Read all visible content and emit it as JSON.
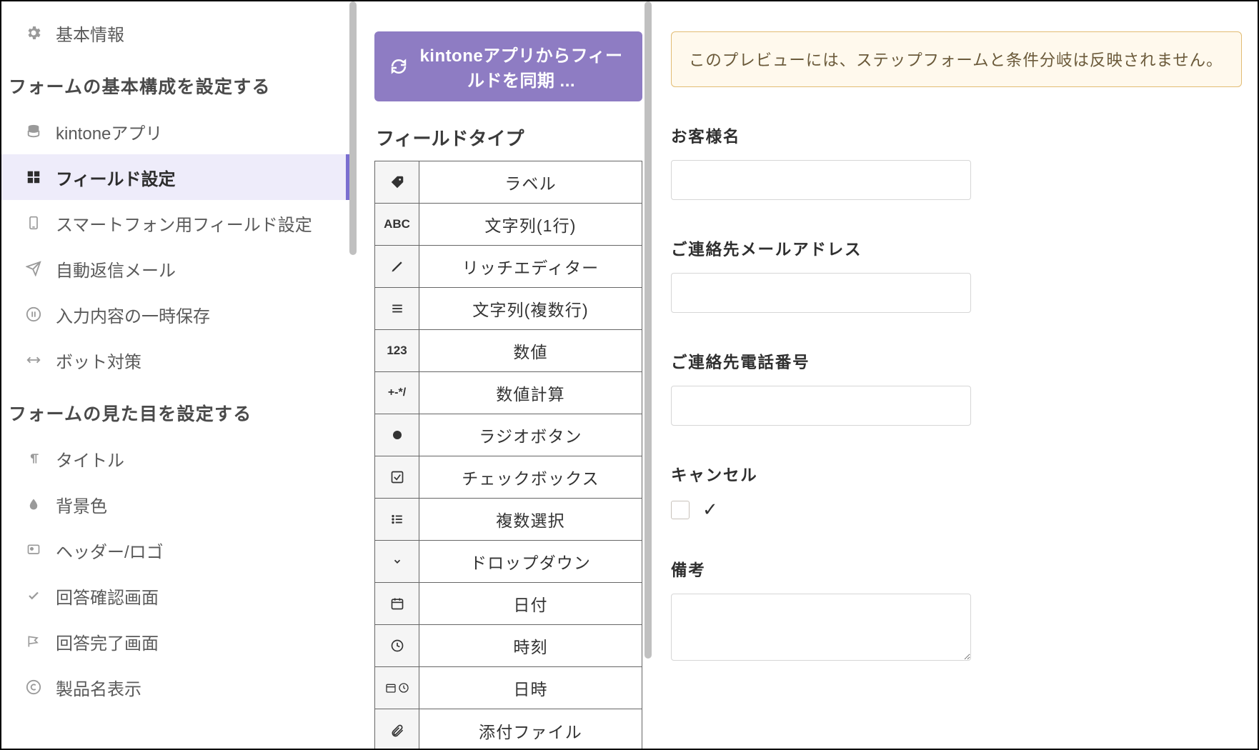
{
  "sidebar": {
    "basic": "基本情報",
    "section1": "フォームの基本構成を設定する",
    "items1": [
      {
        "label": "kintoneアプリ"
      },
      {
        "label": "フィールド設定"
      },
      {
        "label": "スマートフォン用フィールド設定"
      },
      {
        "label": "自動返信メール"
      },
      {
        "label": "入力内容の一時保存"
      },
      {
        "label": "ボット対策"
      }
    ],
    "section2": "フォームの見た目を設定する",
    "items2": [
      {
        "label": "タイトル"
      },
      {
        "label": "背景色"
      },
      {
        "label": "ヘッダー/ロゴ"
      },
      {
        "label": "回答確認画面"
      },
      {
        "label": "回答完了画面"
      },
      {
        "label": "製品名表示"
      }
    ]
  },
  "sync_button": "kintoneアプリからフィールドを同期 ...",
  "mid_heading": "フィールドタイプ",
  "fieldtypes": [
    {
      "icon": "tag",
      "label": "ラベル"
    },
    {
      "icon": "ABC",
      "label": "文字列(1行)"
    },
    {
      "icon": "pencil",
      "label": "リッチエディター"
    },
    {
      "icon": "bars",
      "label": "文字列(複数行)"
    },
    {
      "icon": "123",
      "label": "数値"
    },
    {
      "icon": "+-*/",
      "label": "数値計算"
    },
    {
      "icon": "dot",
      "label": "ラジオボタン"
    },
    {
      "icon": "cbox",
      "label": "チェックボックス"
    },
    {
      "icon": "list",
      "label": "複数選択"
    },
    {
      "icon": "chev",
      "label": "ドロップダウン"
    },
    {
      "icon": "cal",
      "label": "日付"
    },
    {
      "icon": "clock",
      "label": "時刻"
    },
    {
      "icon": "calclk",
      "label": "日時"
    },
    {
      "icon": "clip",
      "label": "添付ファイル"
    }
  ],
  "preview": {
    "alert": "このプレビューには、ステップフォームと条件分岐は反映されません。",
    "f1": "お客様名",
    "f2": "ご連絡先メールアドレス",
    "f3": "ご連絡先電話番号",
    "f4": "キャンセル",
    "check": "✓",
    "f5": "備考"
  }
}
